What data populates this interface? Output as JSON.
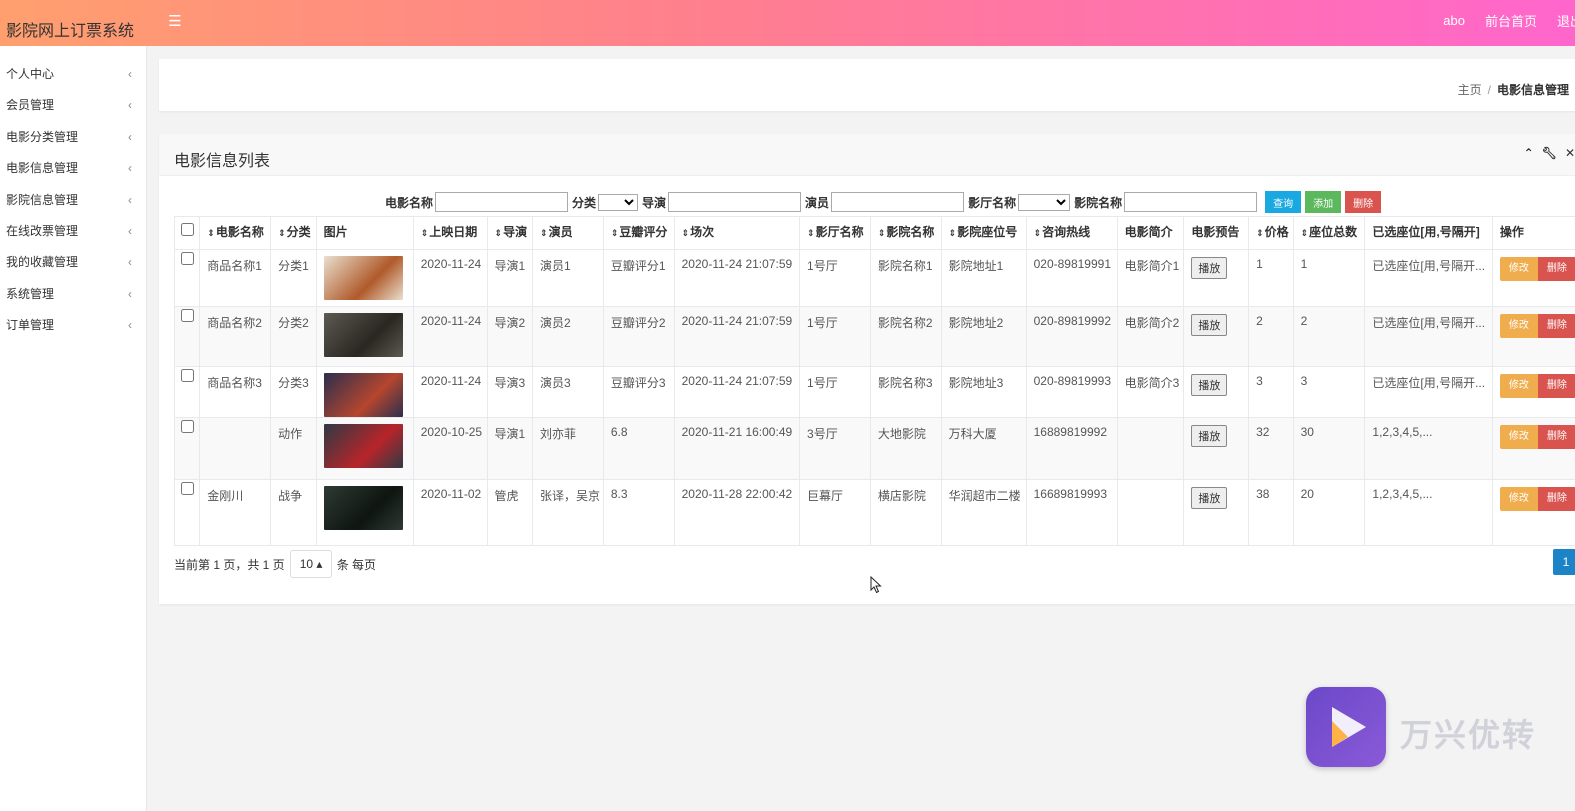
{
  "app": {
    "title": "影院网上订票系统"
  },
  "topbar": {
    "menu_icon": "hamburger-icon",
    "user": "abo",
    "front_link": "前台首页",
    "logout_link": "退出"
  },
  "sidebar": {
    "items": [
      {
        "label": "个人中心"
      },
      {
        "label": "会员管理"
      },
      {
        "label": "电影分类管理"
      },
      {
        "label": "电影信息管理"
      },
      {
        "label": "影院信息管理"
      },
      {
        "label": "在线改票管理"
      },
      {
        "label": "我的收藏管理"
      },
      {
        "label": "系统管理"
      },
      {
        "label": "订单管理"
      }
    ]
  },
  "breadcrumb": {
    "home": "主页",
    "sep": "/",
    "current": "电影信息管理"
  },
  "panel": {
    "title": "电影信息列表"
  },
  "search": {
    "movie_name_label": "电影名称",
    "category_label": "分类",
    "director_label": "导演",
    "actor_label": "演员",
    "hall_label": "影厅名称",
    "cinema_label": "影院名称",
    "query_button": "查询",
    "add_button": "添加",
    "delete_button": "删除"
  },
  "table": {
    "headers": [
      "电影名称",
      "分类",
      "图片",
      "上映日期",
      "导演",
      "演员",
      "豆瓣评分",
      "场次",
      "影厅名称",
      "影院名称",
      "影院座位号",
      "咨询热线",
      "电影简介",
      "电影预告",
      "价格",
      "座位总数",
      "已选座位[用,号隔开]",
      "操作"
    ],
    "play_label": "播放",
    "edit_label": "修改",
    "delete_label": "删除",
    "rows": [
      {
        "name": "商品名称1",
        "category": "分类1",
        "date": "2020-11-24",
        "director": "导演1",
        "actor": "演员1",
        "rating": "豆瓣评分1",
        "showtime": "2020-11-24 21:07:59",
        "hall": "1号厅",
        "cinema": "影院名称1",
        "seat_no": "影院地址1",
        "hotline": "020-89819991",
        "intro": "电影简介1",
        "price": "1",
        "seats_total": "1",
        "selected": "已选座位[用,号隔开..."
      },
      {
        "name": "商品名称2",
        "category": "分类2",
        "date": "2020-11-24",
        "director": "导演2",
        "actor": "演员2",
        "rating": "豆瓣评分2",
        "showtime": "2020-11-24 21:07:59",
        "hall": "1号厅",
        "cinema": "影院名称2",
        "seat_no": "影院地址2",
        "hotline": "020-89819992",
        "intro": "电影简介2",
        "price": "2",
        "seats_total": "2",
        "selected": "已选座位[用,号隔开..."
      },
      {
        "name": "商品名称3",
        "category": "分类3",
        "date": "2020-11-24",
        "director": "导演3",
        "actor": "演员3",
        "rating": "豆瓣评分3",
        "showtime": "2020-11-24 21:07:59",
        "hall": "1号厅",
        "cinema": "影院名称3",
        "seat_no": "影院地址3",
        "hotline": "020-89819993",
        "intro": "电影简介3",
        "price": "3",
        "seats_total": "3",
        "selected": "已选座位[用,号隔开..."
      },
      {
        "name": "",
        "category": "动作",
        "date": "2020-10-25",
        "director": "导演1",
        "actor": "刘亦菲",
        "rating": "6.8",
        "showtime": "2020-11-21 16:00:49",
        "hall": "3号厅",
        "cinema": "大地影院",
        "seat_no": "万科大厦",
        "hotline": "16889819992",
        "intro": "",
        "price": "32",
        "seats_total": "30",
        "selected": "1,2,3,4,5,..."
      },
      {
        "name": "金刚川",
        "category": "战争",
        "date": "2020-11-02",
        "director": "管虎",
        "actor": "张译，吴京",
        "rating": "8.3",
        "showtime": "2020-11-28 22:00:42",
        "hall": "巨幕厅",
        "cinema": "横店影院",
        "seat_no": "华润超市二楼",
        "hotline": "16689819993",
        "intro": "",
        "price": "38",
        "seats_total": "20",
        "selected": "1,2,3,4,5,..."
      }
    ]
  },
  "pager": {
    "prefix": "当前第 1 页，共 1 页",
    "page_size": "10",
    "suffix": "条 每页",
    "current_page": "1"
  },
  "watermark": {
    "text": "万兴优转"
  },
  "colors": {
    "accent": "#1c84c6",
    "topbar_start": "#ff9f6e",
    "topbar_end": "#ff66cc",
    "edit": "#f0ad4e",
    "delete": "#d9534f",
    "add": "#5cb85c"
  }
}
